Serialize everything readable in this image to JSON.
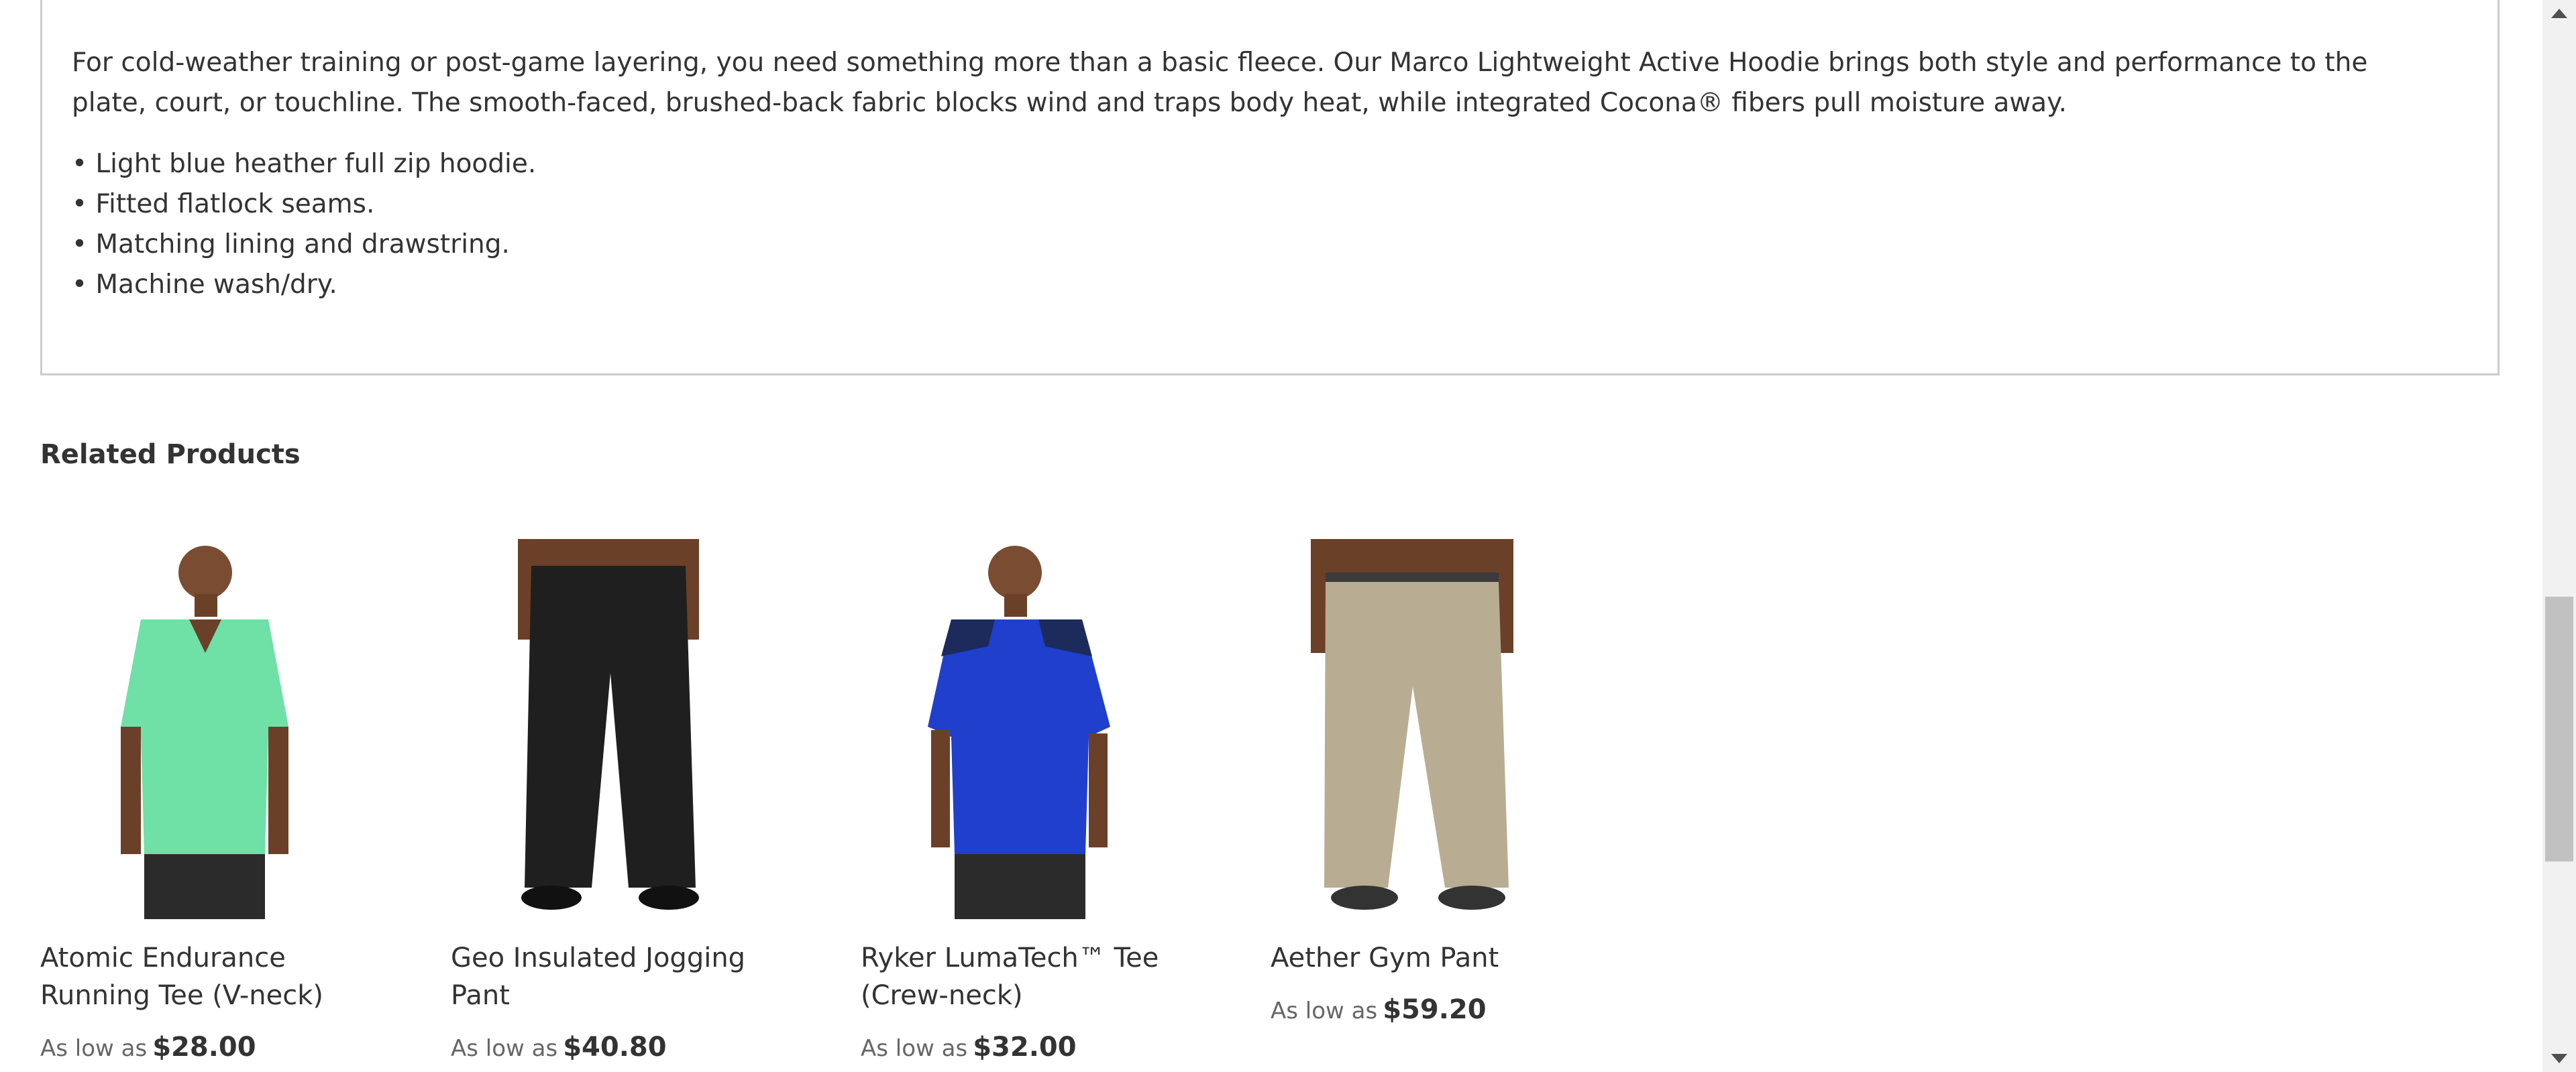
{
  "description": {
    "paragraph": "For cold-weather training or post-game layering, you need something more than a basic fleece. Our Marco Lightweight Active Hoodie brings both style and performance to the plate, court, or touchline. The smooth-faced, brushed-back fabric blocks wind and traps body heat, while integrated Cocona® fibers pull moisture away.",
    "bullets": [
      "• Light blue heather full zip hoodie.",
      "• Fitted flatlock seams.",
      "• Matching lining and drawstring.",
      "• Machine wash/dry."
    ]
  },
  "related": {
    "title": "Related Products",
    "products": [
      {
        "name": "Atomic Endurance Running Tee (V-neck)",
        "price_prefix": "As low as",
        "price": "$28.00",
        "shirt_color": "#6fe0a6",
        "pants_color": "#2b2b2b"
      },
      {
        "name": "Geo Insulated Jogging Pant",
        "price_prefix": "As low as",
        "price": "$40.80",
        "shirt_color": "#1f1f1f",
        "pants_color": "#1f1f1f"
      },
      {
        "name": "Ryker LumaTech™ Tee (Crew-neck)",
        "price_prefix": "As low as",
        "price": "$32.00",
        "shirt_color": "#1f3fcc",
        "pants_color": "#2b2b2b"
      },
      {
        "name": "Aether Gym Pant",
        "price_prefix": "As low as",
        "price": "$59.20",
        "shirt_color": "#b8ad92",
        "pants_color": "#b8ad92"
      }
    ]
  }
}
